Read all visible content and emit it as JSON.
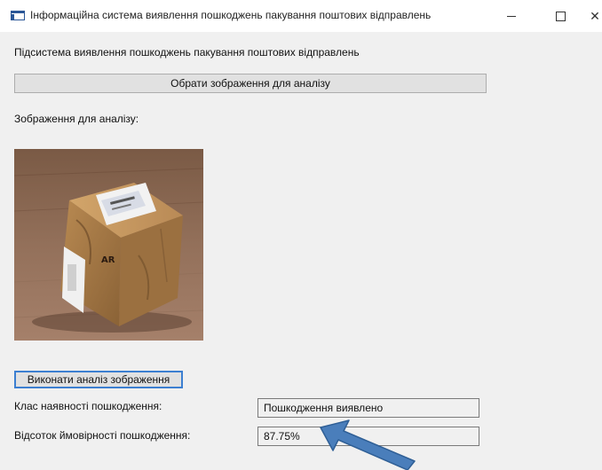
{
  "window": {
    "title": "Інформаційна система виявлення пошкоджень пакування поштових відправлень",
    "minimize_icon": "minimize-icon",
    "maximize_icon": "maximize-icon",
    "close_icon": "close-icon",
    "close_glyph": "✕"
  },
  "main": {
    "subsystem_label": "Підсистема виявлення пошкоджень пакування поштових відправлень",
    "select_image_button": "Обрати зображення для аналізу",
    "image_label": "Зображення для аналізу:",
    "analyze_button": "Виконати аналіз зображення",
    "damage_class_label": "Клас наявності пошкодження:",
    "damage_class_value": "Пошкодження виявлено",
    "probability_label": "Відсоток ймовірності пошкодження:",
    "probability_value": "87.75%"
  },
  "colors": {
    "window_bg": "#f0f0f0",
    "button_bg": "#e1e1e1",
    "focus_border": "#3c7fd1",
    "arrow_fill": "#4a7ebb"
  }
}
